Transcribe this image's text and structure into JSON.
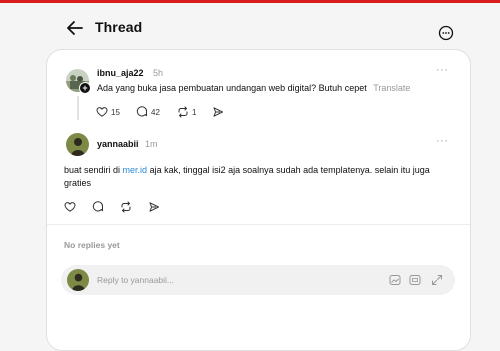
{
  "header": {
    "title": "Thread"
  },
  "original_post": {
    "username": "ibnu_aja22",
    "time": "5h",
    "text": "Ada yang buka jasa pembuatan undangan web digital? Butuh cepet",
    "translate_label": "Translate",
    "likes": "15",
    "comments": "42",
    "reposts": "1"
  },
  "reply_post": {
    "username": "yannaabii",
    "time": "1m",
    "text_before": "buat sendiri di ",
    "link": "mer.id",
    "text_after": " aja kak, tinggal isi2 aja soalnya sudah ada templatenya. selain itu juga graties"
  },
  "replies_section": {
    "empty_label": "No replies yet"
  },
  "reply_input": {
    "placeholder": "Reply to yannaabii..."
  },
  "icons": [
    "back-arrow-icon",
    "more-icon",
    "heart-icon",
    "comment-icon",
    "repost-icon",
    "share-icon",
    "image-icon",
    "gif-icon",
    "expand-icon"
  ]
}
